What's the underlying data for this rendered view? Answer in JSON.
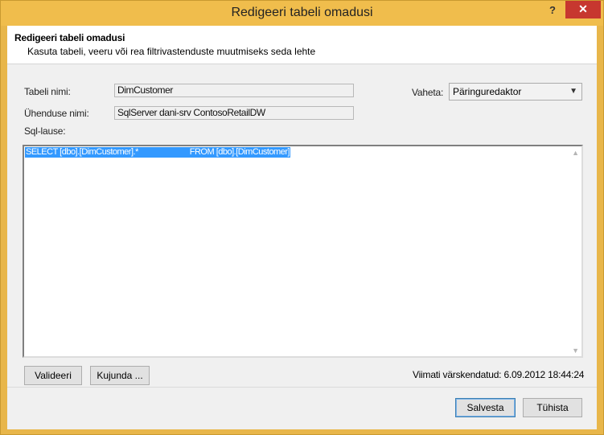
{
  "window": {
    "title": "Redigeeri tabeli omadusi",
    "help_label": "?",
    "close_label": "✕"
  },
  "header": {
    "title": "Redigeeri tabeli omadusi",
    "subtitle": "Kasuta tabeli, veeru või rea filtrivastenduste muutmiseks seda lehte"
  },
  "form": {
    "table_name_label": "Tabeli nimi:",
    "table_name_value": "DimCustomer",
    "connection_label": "Ühenduse nimi:",
    "connection_value": "SqlServer dani-srv ContosoRetailDW",
    "switch_label": "Vaheta:",
    "switch_value": "Päringuredaktor",
    "sql_label": "Sql-lause:",
    "sql_text": "SELECT [dbo].[DimCustomer].*                         FROM [dbo].[DimCustomer]"
  },
  "actions": {
    "validate_label": "Valideeri",
    "design_label": "Kujunda ...",
    "last_updated": "Viimati värskendatud: 6.09.2012 18:44:24"
  },
  "footer": {
    "save_label": "Salvesta",
    "cancel_label": "Tühista"
  },
  "icons": {
    "dropdown": "chevron-down-icon",
    "scroll_up": "scroll-up-icon",
    "scroll_down": "scroll-down-icon"
  },
  "colors": {
    "titlebar": "#f0bd4c",
    "close_button": "#c7372f",
    "selection": "#3399ff"
  }
}
